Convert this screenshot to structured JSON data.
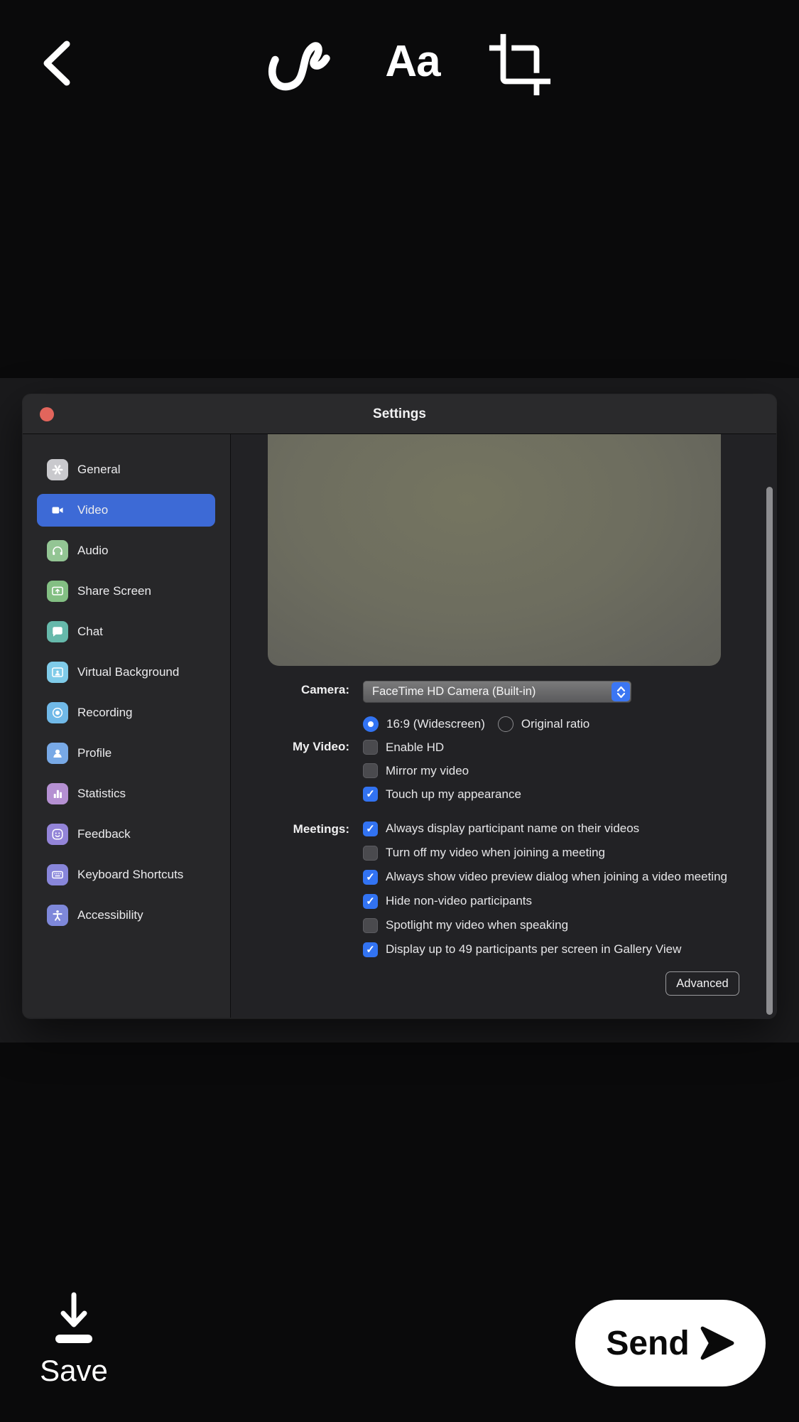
{
  "toolbar": {
    "text_tool_label": "Aa"
  },
  "window": {
    "title": "Settings",
    "sidebar": [
      {
        "label": "General",
        "icon": "gear",
        "color": "#c9c9cd",
        "selected": false
      },
      {
        "label": "Video",
        "icon": "video-camera",
        "color": "transparent",
        "selected": true
      },
      {
        "label": "Audio",
        "icon": "headphones",
        "color": "#93c594",
        "selected": false
      },
      {
        "label": "Share Screen",
        "icon": "share-screen",
        "color": "#83bf83",
        "selected": false
      },
      {
        "label": "Chat",
        "icon": "chat-bubble",
        "color": "#66b9ab",
        "selected": false
      },
      {
        "label": "Virtual Background",
        "icon": "virtual-background",
        "color": "#7fcbe9",
        "selected": false
      },
      {
        "label": "Recording",
        "icon": "record",
        "color": "#70b9e8",
        "selected": false
      },
      {
        "label": "Profile",
        "icon": "person",
        "color": "#78a9e6",
        "selected": false
      },
      {
        "label": "Statistics",
        "icon": "bar-chart",
        "color": "#b590d2",
        "selected": false
      },
      {
        "label": "Feedback",
        "icon": "smiley",
        "color": "#9384d8",
        "selected": false
      },
      {
        "label": "Keyboard Shortcuts",
        "icon": "keyboard",
        "color": "#8886da",
        "selected": false
      },
      {
        "label": "Accessibility",
        "icon": "accessibility",
        "color": "#7e88da",
        "selected": false
      }
    ],
    "video_panel": {
      "camera_label": "Camera:",
      "camera_value": "FaceTime HD Camera (Built-in)",
      "ratio_options": [
        {
          "label": "16:9 (Widescreen)",
          "selected": true
        },
        {
          "label": "Original ratio",
          "selected": false
        }
      ],
      "my_video_label": "My Video:",
      "my_video_options": [
        {
          "label": "Enable HD",
          "checked": false
        },
        {
          "label": "Mirror my video",
          "checked": false
        },
        {
          "label": "Touch up my appearance",
          "checked": true
        }
      ],
      "meetings_label": "Meetings:",
      "meetings_options": [
        {
          "label": "Always display participant name on their videos",
          "checked": true
        },
        {
          "label": "Turn off my video when joining a meeting",
          "checked": false
        },
        {
          "label": "Always show video preview dialog when joining a video meeting",
          "checked": true
        },
        {
          "label": "Hide non-video participants",
          "checked": true
        },
        {
          "label": "Spotlight my video when speaking",
          "checked": false
        },
        {
          "label": "Display up to 49 participants per screen in Gallery View",
          "checked": true
        }
      ],
      "advanced_label": "Advanced"
    }
  },
  "footer": {
    "save_label": "Save",
    "send_label": "Send"
  },
  "colors": {
    "accent_blue": "#3d6ad6",
    "checkbox_blue": "#3273f2",
    "close_red": "#e2655c"
  }
}
